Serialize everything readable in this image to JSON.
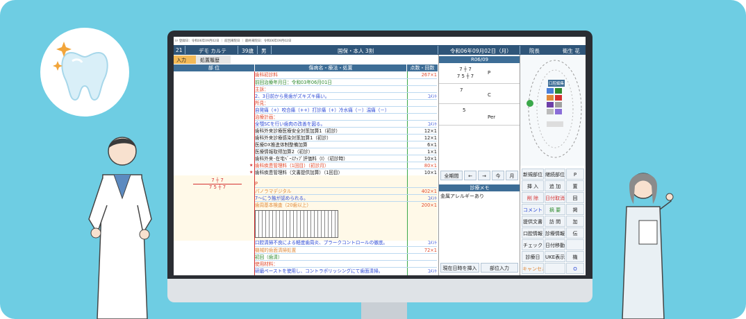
{
  "header": {
    "patient_no": "21",
    "name": "デモ カルテ",
    "age": "39歳",
    "sex": "男",
    "insurance": "国保・本人 3割",
    "date": "令和06年09月02日（月）",
    "doctor": "院長",
    "hygienist": "衛生 花"
  },
  "tabs": [
    {
      "label": "入力"
    },
    {
      "label": "処置履歴"
    }
  ],
  "columns": {
    "part": "部 位",
    "disease": "傷病名・療法・処置",
    "points": "点数・回数"
  },
  "entries1": [
    {
      "text": "歯科初診料",
      "value": "267×1",
      "color": "red"
    },
    {
      "text": "前回治療年月日：令和03年06月01日",
      "value": "",
      "color": "grn"
    },
    {
      "text": "主訴：",
      "value": "",
      "color": "red"
    },
    {
      "text": "2、3日前から奥歯がズキズキ痛い。",
      "value": "ｺﾒﾝﾄ",
      "color": "blue"
    },
    {
      "text": "所見：",
      "value": "",
      "color": "red"
    },
    {
      "text": "自発痛（+）咬合痛（++）打診痛（+）冷水痛（－）温痛（－）",
      "value": "",
      "color": "blue"
    },
    {
      "text": "治療計画：",
      "value": "",
      "color": "red"
    },
    {
      "text": "全顎SCを行い歯肉の改善を図る。",
      "value": "ｺﾒﾝﾄ",
      "color": "blue"
    },
    {
      "text": "歯科外来診療医療安全対策加算1（初診）",
      "value": "12×1",
      "color": "blk"
    },
    {
      "text": "歯科外来診療感染対策加算1（初診）",
      "value": "12×1",
      "color": "blk"
    },
    {
      "text": "医療DX推進体制整備加算",
      "value": "6×1",
      "color": "blk"
    },
    {
      "text": "医療情報取得加算2（初診）",
      "value": "1×1",
      "color": "blk"
    },
    {
      "text": "歯科外来･在宅ﾍﾞｰｽｱｯﾌﾟ評価料（Ⅰ）（初診時）",
      "value": "10×1",
      "color": "blk"
    },
    {
      "text": "歯科疾患管理料（1回目）（初診月）",
      "value": "80×1",
      "color": "red"
    },
    {
      "text": "歯科疾患管理料（文書提供加算）（1回目）",
      "value": "10×1",
      "color": "blk"
    }
  ],
  "entries2": [
    {
      "text": "P",
      "value": "",
      "color": "red"
    },
    {
      "text": "パノラマデジタル",
      "value": "402×1",
      "color": "orn"
    },
    {
      "text": "7～にう蝕が認められる。",
      "value": "ｺﾒﾝﾄ",
      "color": "blue"
    },
    {
      "text": "歯周基本検査（20歯以上）",
      "value": "200×1",
      "color": "orn"
    }
  ],
  "entries3": [
    {
      "text": "口腔清掃不良による軽度歯周炎、プラークコントロールの徹底。",
      "value": "ｺﾒﾝﾄ",
      "color": "blue"
    },
    {
      "text": "機械的歯面清掃処置",
      "value": "72×1",
      "color": "orn"
    },
    {
      "text": "初回（歯清）",
      "value": "",
      "color": "grn"
    },
    {
      "text": "使用材料：",
      "value": "",
      "color": "red"
    },
    {
      "text": "研磨ペーストを使用し、コントラポリッシングにて歯面清掃。",
      "value": "ｺﾒﾝﾄ",
      "color": "blue"
    }
  ],
  "tooth_chart": {
    "upper": "7 ┼ 7",
    "lower": "7 5 ┼ 7"
  },
  "mid": {
    "period": "R06/09",
    "rows": [
      {
        "t1": "7 ┼ 7",
        "t2": "7 5 ┼ 7",
        "code": "P"
      },
      {
        "t1": "7",
        "t2": "",
        "code": "C"
      },
      {
        "t1": "5",
        "t2": "",
        "code": "Per"
      }
    ],
    "nav": [
      "全期間",
      "←",
      "→",
      "今",
      "月"
    ],
    "memo_title": "診療メモ",
    "memo": "金属アレルギーあり",
    "bottom": [
      "現在日時を挿入",
      "部位入力"
    ]
  },
  "right": {
    "buttons": [
      [
        "新規部位",
        "継続部位",
        "P"
      ],
      [
        "挿 入",
        "追 加",
        "置"
      ],
      [
        "削 除",
        "日付取消",
        "回"
      ],
      [
        "コメント",
        "摘 要",
        "掲"
      ],
      [
        "提供文書",
        "訪 問",
        "加"
      ],
      [
        "口腔情報",
        "診療情報",
        "伝"
      ],
      [
        "チェック",
        "日付移動",
        ""
      ],
      [
        "診療日",
        "UKE表示",
        "機"
      ],
      [
        "キャンセル",
        "",
        "O"
      ]
    ],
    "chart_label": "口腔編集",
    "tags": [
      "ペ",
      "ブ",
      "欠",
      "残",
      "イ",
      "補",
      "ア",
      "根"
    ]
  }
}
